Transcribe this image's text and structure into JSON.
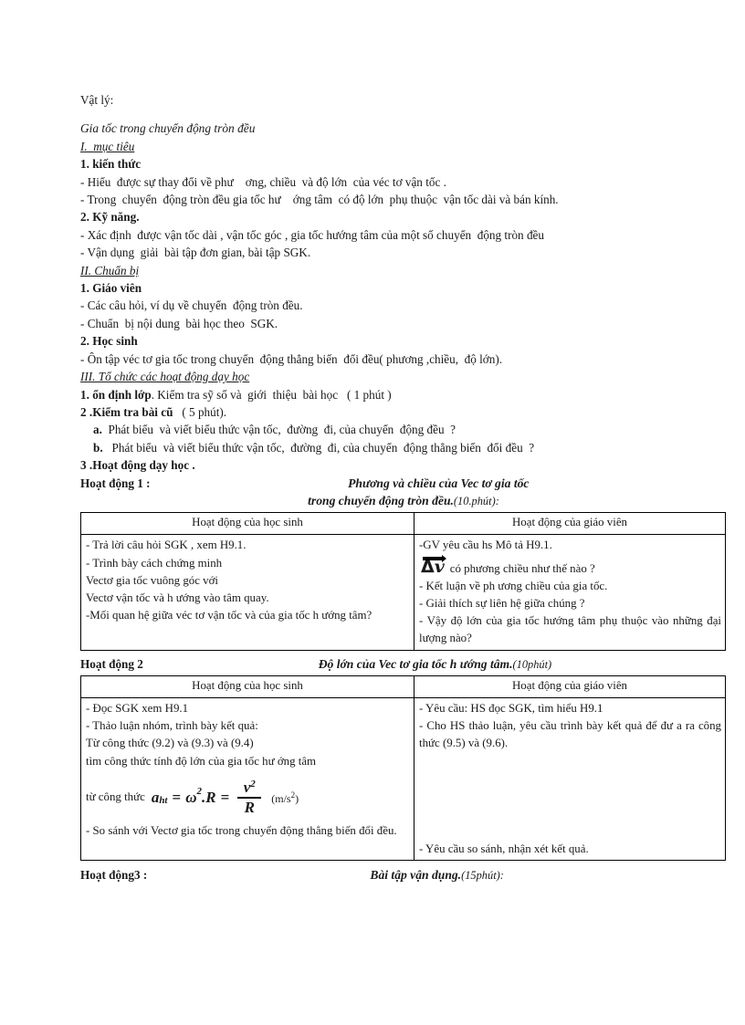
{
  "document": {
    "subject_label": "Vật lý:",
    "title": "Gia tốc trong chuyển động tròn đều",
    "sections": {
      "s1_heading": "I.  mục tiêu",
      "s1_1_heading": "1. kiến thức",
      "s1_1_b1": "- Hiểu  được sự thay đổi về phư    ơng, chiều  và độ lớn  của véc tơ vận tốc .",
      "s1_1_b2": "- Trong  chuyển  động tròn đều gia tốc hư    ớng tâm  có độ lớn  phụ thuộc  vận tốc dài và bán kính.",
      "s1_2_heading": "2. Kỹ năng.",
      "s1_2_b1": "- Xác định  được vận tốc dài , vận tốc góc , gia tốc hướng tâm của một số chuyển  động tròn đều",
      "s1_2_b2": "- Vận dụng  giải  bài tập đơn gian, bài tập SGK.",
      "s2_heading": "II. Chuẩn bị",
      "s2_1_heading": "1. Giáo viên",
      "s2_1_b1": "- Các câu hỏi, ví dụ về chuyển  động tròn đều.",
      "s2_1_b2": "- Chuẩn  bị nội dung  bài học theo  SGK.",
      "s2_2_heading": "2. Học sinh",
      "s2_2_b1": "- Ôn tập véc tơ gia tốc trong chuyển  động thẳng biến  đổi đều( phương ,chiều,  độ lớn).",
      "s3_heading": "III. Tổ chức các hoạt động dạy học",
      "s3_1_bold": "1. ổn định lớp",
      "s3_1_rest": ". Kiểm tra sỹ số và  giới  thiệu  bài học   ( 1 phút )",
      "s3_2_bold": "2 .Kiểm tra bài cũ",
      "s3_2_rest": "   ( 5 phút).",
      "s3_2_a_bold": "a.",
      "s3_2_a_rest": "  Phát biểu  và viết biểu thức vận tốc,  đường  đi, của chuyển  động đều  ?",
      "s3_2_b_bold": "b.",
      "s3_2_b_rest": "   Phát biểu  và viết biểu thức vận tốc,  đường  đi, của chuyển  động thẳng biến  đổi đều  ?",
      "s3_3_heading": "3 .Hoạt động dạy học ."
    }
  },
  "activity1": {
    "label": "Hoạt động 1 :",
    "title_line1": "Phương và chiều của Vec tơ gia tốc",
    "title_line2": "trong chuyển động tròn đều.",
    "time": "(10.phút):",
    "columns": [
      "Hoạt động của học sinh",
      "Hoạt động của giáo viên"
    ],
    "student": [
      "- Trả lời câu hỏi  SGK , xem H9.1.",
      "- Trình  bày cách chứng  minh",
      "Vectơ gia tốc vuông  góc với",
      "Vectơ vận tốc và h    ướng vào tâm quay.",
      "-Mối  quan  hệ giữa  véc  tơ vận  tốc  và    của gia  tốc  h    ướng tâm?"
    ],
    "teacher": {
      "line1": "-GV yêu  cầu hs  Mô tả H9.1.",
      "delta_symbol": "Δ",
      "delta_var": "v",
      "line2_after_symbol": "có phương  chiều  như  thế nào ?",
      "line3": "- Kết luận  về ph    ương chiều  của gia tốc.",
      "line4": "- Giải  thích  sự liên  hệ giữa  chúng  ?",
      "line5": "- Vậy độ lớn  của gia  tốc  hướng  tâm  phụ  thuộc vào  những  đại lượng  nào?"
    }
  },
  "activity2": {
    "label": "Hoạt động 2",
    "title": "Độ lớn của Vec tơ gia tốc h    ướng tâm.",
    "time": "(10phút)",
    "columns": [
      "Hoạt động của học sinh",
      "Hoạt động của giáo viên"
    ],
    "student": {
      "line1": "- Đọc SGK xem  H9.1",
      "line2": "- Thảo luận  nhóm,  trình  bày kết quả:",
      "line3": "  Từ công  thức  (9.2) và (9.3) và (9.4)",
      "line4": "tìm  công  thức tính  độ lớn  của gia  tốc hư    ớng  tâm",
      "formula_lead": "từ công thức",
      "formula": {
        "a": "a",
        "a_sub": "ht",
        "eq1": "=",
        "omega": "ω",
        "omega_sup": "2",
        "dot_R": ".R",
        "eq2": "=",
        "num": "v",
        "num_sup": "2",
        "den": "R",
        "units": "(m/s",
        "units_sup": "2",
        "units_close": ")"
      },
      "line5": "- So sánh  với  Vectơ  gia  tốc trong  chuyển  động thẳng biến  đổi đều."
    },
    "teacher": {
      "line1": "- Yêu cầu: HS đọc SGK, tìm  hiểu  H9.1",
      "line2": "- Cho  HS thảo  luận,  yêu  cầu trình  bày  kết  quả  để đư    a ra công thức (9.5) và (9.6).",
      "line3": "- Yêu cầu so sánh, nhận  xét kết quả."
    }
  },
  "activity3": {
    "label": "Hoạt động3 :",
    "title": "Bài tập vận dụng.",
    "time": "(15phút):"
  }
}
